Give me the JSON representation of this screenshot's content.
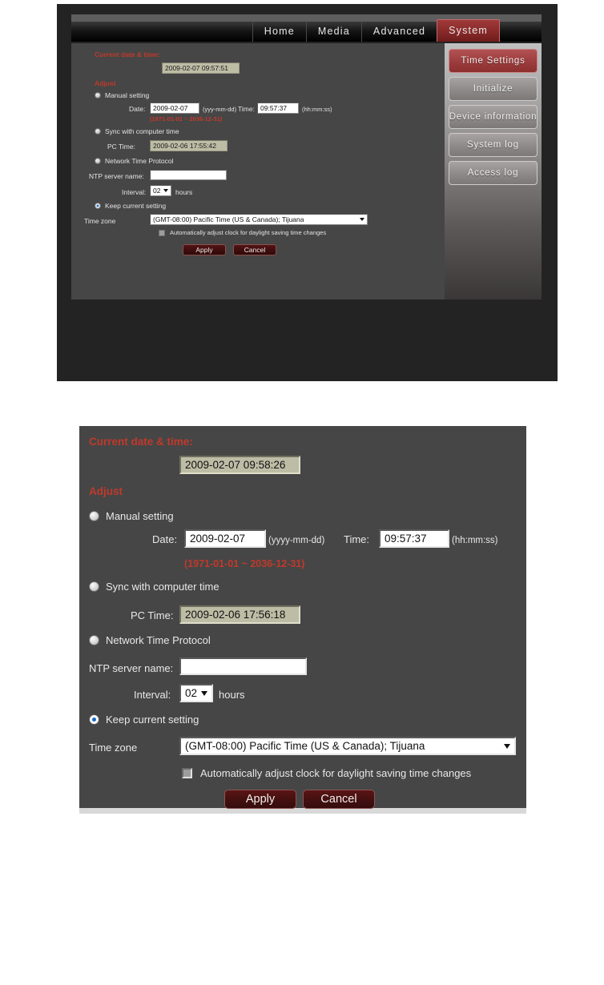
{
  "nav": {
    "items": [
      {
        "label": "Home",
        "active": false
      },
      {
        "label": "Media",
        "active": false
      },
      {
        "label": "Advanced",
        "active": false
      },
      {
        "label": "System",
        "active": true
      }
    ]
  },
  "sidebar": {
    "items": [
      {
        "label": "Time  Settings",
        "active": true
      },
      {
        "label": "Initialize",
        "active": false
      },
      {
        "label": "Device information",
        "active": false
      },
      {
        "label": "System log",
        "active": false
      },
      {
        "label": "Access log",
        "active": false
      }
    ]
  },
  "panel_small": {
    "current_label": "Current date & time:",
    "current_value": "2009-02-07 09:57:51",
    "adjust_label": "Adjust",
    "manual_label": "Manual setting",
    "date_label": "Date:",
    "date_value": "2009-02-07",
    "date_format": "(yyy-mm-dd)",
    "time_label": "Time:",
    "time_value": "09:57:37",
    "time_format": "(hh:mm:ss)",
    "range_note": "(1971-01-01 ~ 2036-12-31)",
    "sync_label": "Sync with computer time",
    "pc_time_label": "PC Time:",
    "pc_time_value": "2009-02-06 17:55:42",
    "ntp_label": "Network Time Protocol",
    "ntp_server_label": "NTP server name:",
    "ntp_server_value": "",
    "interval_label": "Interval:",
    "interval_value": "02",
    "hours_label": "hours",
    "keep_label": "Keep current setting",
    "timezone_label": "Time zone",
    "timezone_value": "(GMT-08:00) Pacific Time (US & Canada); Tijuana",
    "dst_label": "Automatically adjust clock for daylight saving time changes",
    "apply_label": "Apply",
    "cancel_label": "Cancel"
  },
  "panel_large": {
    "current_label": "Current date & time:",
    "current_value": "2009-02-07 09:58:26",
    "adjust_label": "Adjust",
    "manual_label": "Manual setting",
    "date_label": "Date:",
    "date_value": "2009-02-07",
    "date_format": "(yyyy-mm-dd)",
    "time_label": "Time:",
    "time_value": "09:57:37",
    "time_format": "(hh:mm:ss)",
    "range_note": "(1971-01-01 ~ 2036-12-31)",
    "sync_label": "Sync with computer time",
    "pc_time_label": "PC Time:",
    "pc_time_value": "2009-02-06 17:56:18",
    "ntp_label": "Network Time Protocol",
    "ntp_server_label": "NTP server name:",
    "ntp_server_value": "",
    "interval_label": "Interval:",
    "interval_value": "02",
    "hours_label": "hours",
    "keep_label": "Keep current setting",
    "timezone_label": "Time zone",
    "timezone_value": "(GMT-08:00) Pacific Time (US & Canada); Tijuana",
    "dst_label": "Automatically adjust clock for daylight saving time changes",
    "apply_label": "Apply",
    "cancel_label": "Cancel"
  },
  "colors": {
    "accent_red": "#a03a3a",
    "label_red": "#c0392b",
    "panel_bg": "#464646",
    "readonly_bg": "#bdbda6"
  }
}
